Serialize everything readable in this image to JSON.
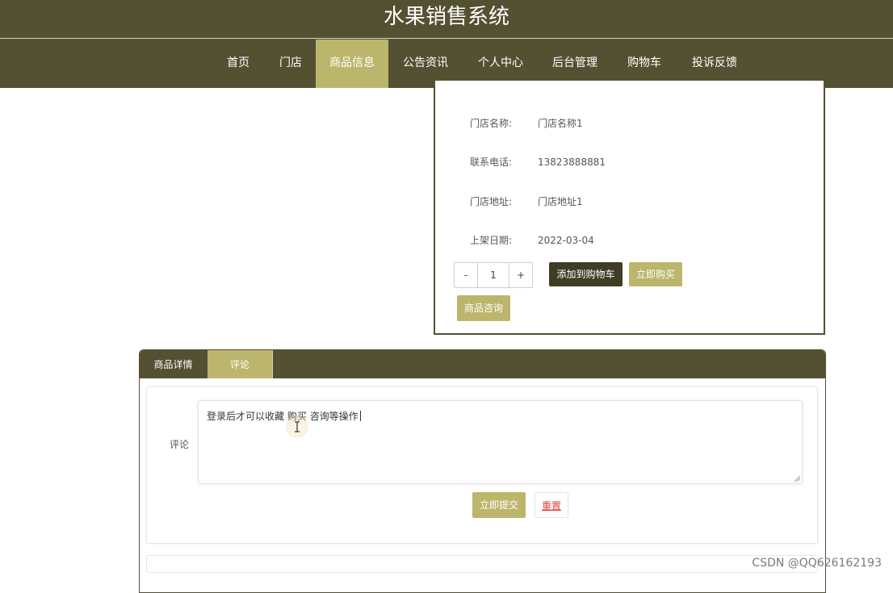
{
  "header": {
    "title": "水果销售系统",
    "nav": [
      "首页",
      "门店",
      "商品信息",
      "公告资讯",
      "个人中心",
      "后台管理",
      "购物车",
      "投诉反馈"
    ],
    "active_nav": "商品信息"
  },
  "store_info": {
    "rows": [
      {
        "label": "门店名称:",
        "value": "门店名称1"
      },
      {
        "label": "联系电话:",
        "value": "13823888881"
      },
      {
        "label": "门店地址:",
        "value": "门店地址1"
      },
      {
        "label": "上架日期:",
        "value": "2022-03-04"
      }
    ],
    "stepper": {
      "minus": "-",
      "quantity": "1",
      "plus": "+"
    },
    "add_to_cart": "添加到购物车",
    "buy_now": "立即购买",
    "consult": "商品咨询"
  },
  "tabs": {
    "items": [
      "商品详情",
      "评论"
    ],
    "active": "评论"
  },
  "comment": {
    "label": "评论",
    "text": "登录后才可以收藏 购买 咨询等操作",
    "submit": "立即提交",
    "reset": "重置"
  },
  "watermark": "CSDN @QQ626162193",
  "colors": {
    "header_bg": "#545032",
    "accent": "#bcb66c",
    "dark_button": "#3f3d26",
    "reset_text": "#e53935"
  }
}
